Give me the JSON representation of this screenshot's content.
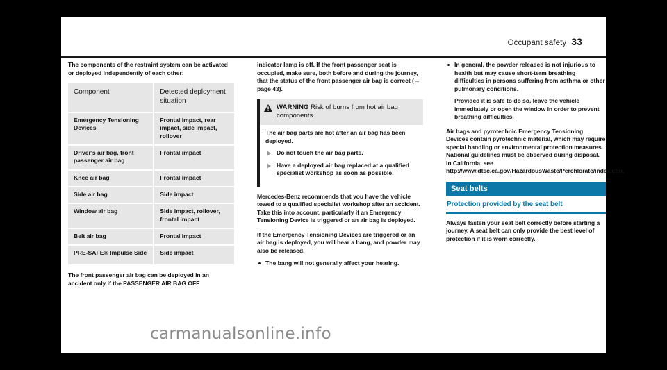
{
  "header": {
    "section": "Occupant safety",
    "page_number": "33"
  },
  "column1": {
    "intro": "The components of the restraint system can be activated or deployed independently of each other:",
    "table": {
      "headers": [
        "Component",
        "Detected deployment situation"
      ],
      "rows": [
        [
          "Emergency Tensioning Devices",
          "Frontal impact, rear impact, side impact, rollover"
        ],
        [
          "Driver's air bag, front passenger air bag",
          "Frontal impact"
        ],
        [
          "Knee air bag",
          "Frontal impact"
        ],
        [
          "Side air bag",
          "Side impact"
        ],
        [
          "Window air bag",
          "Side impact, rollover, frontal impact"
        ],
        [
          "Belt air bag",
          "Frontal impact"
        ],
        [
          "PRE-SAFE® Impulse Side",
          "Side impact"
        ]
      ]
    },
    "after_table": "The front passenger air bag can be deployed in an accident only if the PASSENGER AIR BAG OFF"
  },
  "column2": {
    "continued": "indicator lamp is off. If the front passenger seat is occupied, make sure, both before and during the journey, that the status of the front passenger air bag is correct (→ page 43).",
    "warning": {
      "icon": "warning-triangle-icon",
      "label": "WARNING",
      "title": "Risk of burns from hot air bag components",
      "body": "The air bag parts are hot after an air bag has been deployed.",
      "bullets": [
        "Do not touch the air bag parts.",
        "Have a deployed air bag replaced at a qualified specialist workshop as soon as possible."
      ]
    },
    "para_tow": "Mercedes-Benz recommends that you have the vehicle towed to a qualified specialist workshop after an accident. Take this into account, particularly if an Emergency Tensioning Device is triggered or an air bag is deployed.",
    "para_bang": "If the Emergency Tensioning Devices are triggered or an air bag is deployed, you will hear a bang, and powder may also be released.",
    "bullet_hearing": "The bang will not generally affect your hearing."
  },
  "column3": {
    "bullet_powder": "In general, the powder released is not injurious to health but may cause short-term breathing difficulties in persons suffering from asthma or other pulmonary conditions.",
    "para_leave": "Provided it is safe to do so, leave the vehicle immediately or open the window in order to prevent breathing difficulties.",
    "para_pyro": "Air bags and pyrotechnic Emergency Tensioning Devices contain pyrotechnic material, which may require special handling or environmental protection measures. National guidelines must be observed during disposal. In California, see http://www.dtsc.ca.gov/HazardousWaste/Perchlorate/index.cfm.",
    "section_title": "Seat belts",
    "subsection_title": "Protection provided by the seat belt",
    "para_belt": "Always fasten your seat belt correctly before starting a journey. A seat belt can only provide the best level of protection if it is worn correctly."
  },
  "watermark": "carmanualsonline.info",
  "colors": {
    "accent": "#0b78a8",
    "text": "#141414",
    "table_cell": "#e6e6e6"
  }
}
